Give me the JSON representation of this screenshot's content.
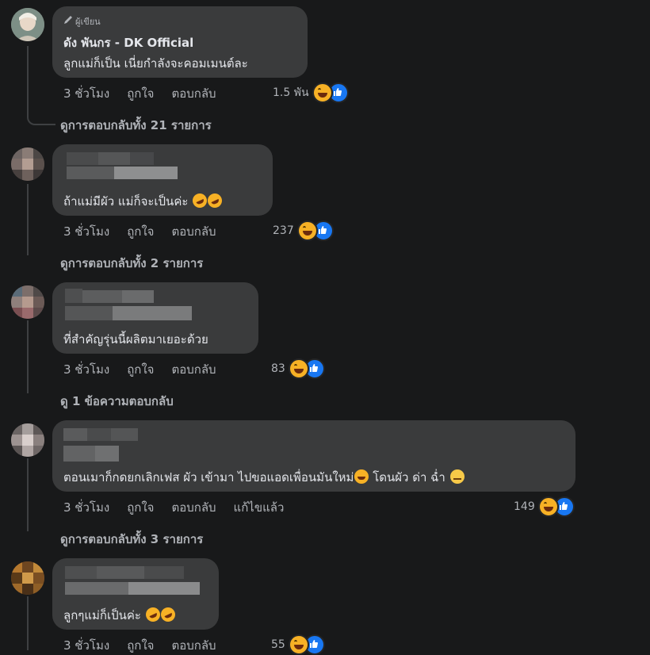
{
  "comments": [
    {
      "badge": "ผู้เขียน",
      "author": "ดัง พันกร - DK Official",
      "text": "ลูกแม่ก็เป็น เนี่ยกำลังจะคอมเมนต์ละ",
      "time": "3 ชั่วโมง",
      "like": "ถูกใจ",
      "reply": "ตอบกลับ",
      "reactions": "1.5 พัน",
      "view_replies": "ดูการตอบกลับทั้ง 21 รายการ"
    },
    {
      "text": "ถ้าแม่มีผัว แม่ก็จะเป็นค่ะ",
      "time": "3 ชั่วโมง",
      "like": "ถูกใจ",
      "reply": "ตอบกลับ",
      "reactions": "237",
      "view_replies": "ดูการตอบกลับทั้ง 2 รายการ"
    },
    {
      "text": "ที่สำคัญรุ่นนี้ผลิตมาเยอะด้วย",
      "time": "3 ชั่วโมง",
      "like": "ถูกใจ",
      "reply": "ตอบกลับ",
      "reactions": "83",
      "view_replies": "ดู 1 ข้อความตอบกลับ"
    },
    {
      "text_a": "ตอนเมาก็กดยกเลิกเฟส ผัว เข้ามา ไปขอแอดเพื่อนมันใหม่",
      "text_b": "โดนผัว ด่า ฉ่ำ",
      "time": "3 ชั่วโมง",
      "like": "ถูกใจ",
      "reply": "ตอบกลับ",
      "edited": "แก้ไขแล้ว",
      "reactions": "149",
      "view_replies": "ดูการตอบกลับทั้ง 3 รายการ"
    },
    {
      "text": "ลูกๆแม่ก็เป็นค่ะ",
      "time": "3 ชั่วโมง",
      "like": "ถูกใจ",
      "reply": "ตอบกลับ",
      "reactions": "55"
    }
  ],
  "icons": {
    "pen": "pencil-icon",
    "haha": "haha-reaction-icon",
    "like": "like-reaction-icon",
    "rofl": "rofl-emoji",
    "relieved": "relieved-emoji"
  },
  "colors": {
    "background": "#18191a",
    "bubble": "#3a3b3c",
    "text": "#e4e6eb",
    "muted": "#b0b3b8",
    "like_blue": "#1877f2",
    "haha_yellow": "#f7b125"
  }
}
